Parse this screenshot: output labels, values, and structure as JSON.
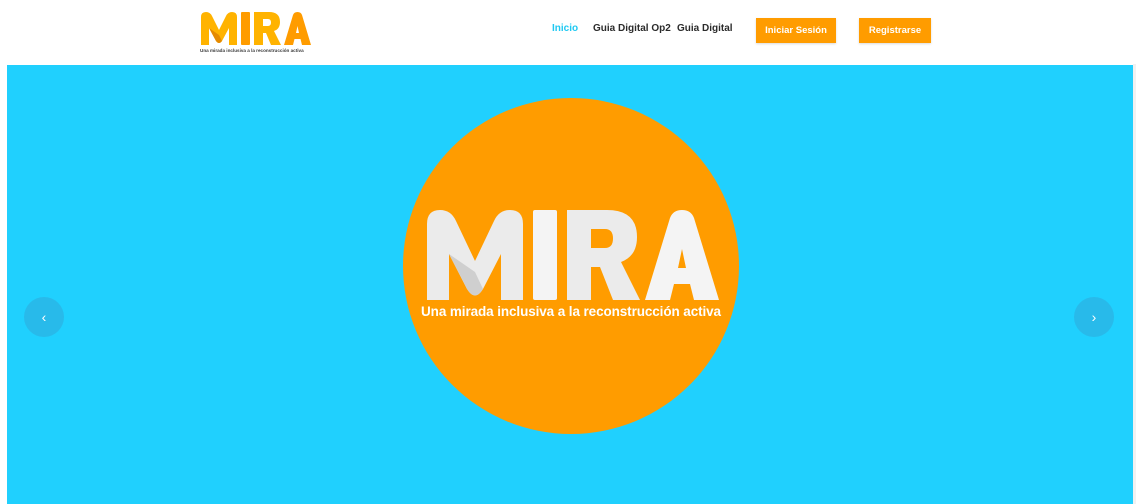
{
  "header": {
    "logo": {
      "word": "MIRA",
      "tagline": "Una mirada inclusiva a la reconstrucción activa"
    },
    "nav": {
      "items": [
        {
          "label": "Inicio",
          "active": true
        },
        {
          "label": "Guia Digital Op2",
          "active": false
        },
        {
          "label": "Guia Digital",
          "active": false
        }
      ],
      "login_label": "Iniciar Sesión",
      "register_label": "Registrarse"
    }
  },
  "slider": {
    "hero_word": "MIRA",
    "hero_tagline": "Una mirada inclusiva a la reconstrucción activa",
    "prev_icon": "chevron-left-icon",
    "next_icon": "chevron-right-icon",
    "prev_glyph": "‹",
    "next_glyph": "›"
  },
  "colors": {
    "accent_orange": "#ff9c00",
    "sky_blue": "#20d0fe",
    "active_link": "#1fc9f2",
    "logo_letters_light": "#ebebeb"
  }
}
